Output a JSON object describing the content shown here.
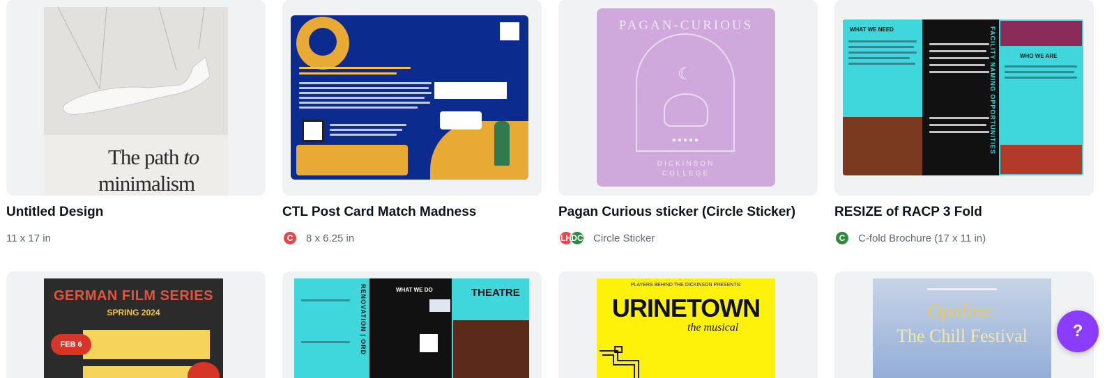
{
  "designs_row1": [
    {
      "title": "Untitled Design",
      "meta": "11 x 17 in",
      "avatars": [],
      "preview": {
        "line1": "The path",
        "line1b": "to",
        "line2": "minimalism"
      }
    },
    {
      "title": "CTL Post Card Match Madness",
      "meta": "8 x 6.25 in",
      "avatars": [
        {
          "initials": "C",
          "color": "#e5484d"
        }
      ],
      "preview": {}
    },
    {
      "title": "Pagan Curious sticker (Circle Sticker)",
      "meta": "Circle Sticker",
      "avatars": [
        {
          "initials": "LH",
          "color": "#e5484d"
        },
        {
          "initials": "DC",
          "color": "#2e8b3e"
        }
      ],
      "preview": {
        "arch_text": "PAGAN-CURIOUS",
        "footer1": "DICKINSON",
        "footer2": "COLLEGE"
      }
    },
    {
      "title": "RESIZE of RACP 3 Fold",
      "meta": "C-fold Brochure (17 x 11 in)",
      "avatars": [
        {
          "initials": "C",
          "color": "#2e8b3e"
        }
      ],
      "preview": {
        "heading1": "WHAT WE NEED",
        "heading2": "WHO WE ARE",
        "vertical": "FACILITY NAMING OPPORTUNITIES"
      }
    }
  ],
  "designs_row2": [
    {
      "preview": {
        "heading": "GERMAN FILM SERIES",
        "sub": "SPRING 2024",
        "badge": "FEB 6"
      }
    },
    {
      "preview": {
        "heading": "WHAT WE DO",
        "brand": "THEATRE",
        "vertical": "RENOVATION | ORD"
      }
    },
    {
      "preview": {
        "top": "PLAYERS BEHIND THE DICKINSON PRESENTS:",
        "heading": "URINETOWN",
        "script": "the musical"
      }
    },
    {
      "preview": {
        "line1": "Opaline:",
        "line2": "The Chill Festival"
      }
    }
  ],
  "help_button": {
    "label": "?"
  },
  "colors": {
    "accent": "#8b3dff",
    "title": "#0e1318",
    "meta": "#5e6673",
    "thumb_bg": "#f1f2f4"
  }
}
